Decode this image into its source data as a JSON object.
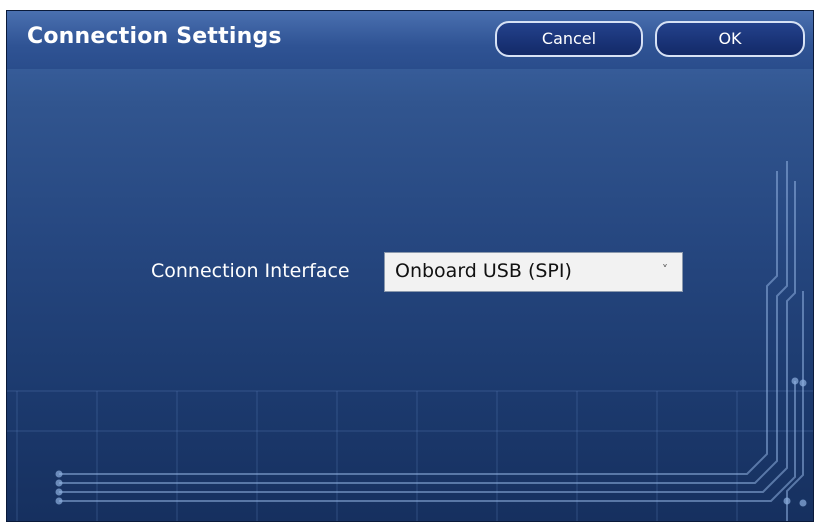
{
  "dialog": {
    "title": "Connection Settings",
    "cancel_label": "Cancel",
    "ok_label": "OK"
  },
  "form": {
    "interface_label": "Connection Interface",
    "interface_value": "Onboard USB (SPI)"
  },
  "icons": {
    "dropdown": "chevron-down-icon"
  },
  "colors": {
    "background_top": "#3f67a8",
    "background_bottom": "#16305f",
    "button_border": "#d7e2f5",
    "text": "#ffffff"
  }
}
